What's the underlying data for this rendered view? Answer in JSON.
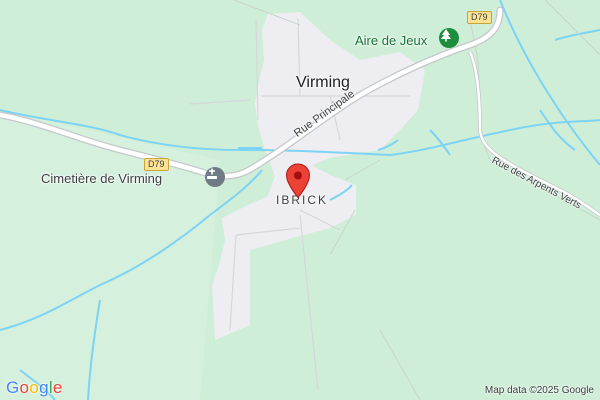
{
  "map": {
    "town_label": "Virming",
    "place_label": "IBRICK",
    "roads": {
      "rue_principale": "Rue Principale",
      "rue_des_arpents_verts": "Rue des Arpents Verts",
      "route_shield": "D79"
    },
    "pois": {
      "park": {
        "label": "Aire de Jeux",
        "icon": "tree-icon",
        "color": "#1e8e3e"
      },
      "cemetery": {
        "label": "Cimetière de Virming",
        "icon": "cemetery-icon",
        "color": "#6f7a87"
      }
    },
    "pin_color": "#ea4335",
    "colors": {
      "land": "#cfeed7",
      "urban": "#eeeef2",
      "water": "#7dd3f5",
      "road": "#ffffff",
      "road_casing": "#c4c7cc"
    }
  },
  "branding": {
    "logo_text": "Google"
  },
  "attribution": "Map data ©2025 Google"
}
